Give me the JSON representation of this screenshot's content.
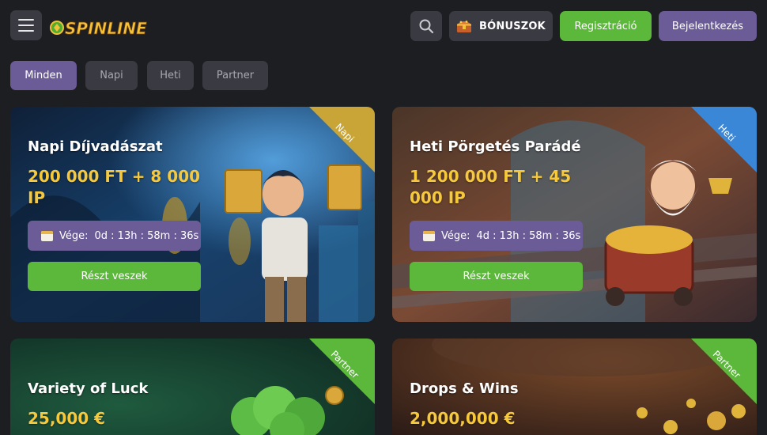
{
  "header": {
    "logo_text": "SPINLINE",
    "bonus_label": "BÓNUSZOK",
    "register_label": "Regisztráció",
    "login_label": "Bejelentkezés"
  },
  "tabs": [
    {
      "label": "Minden",
      "active": true
    },
    {
      "label": "Napi",
      "active": false
    },
    {
      "label": "Heti",
      "active": false
    },
    {
      "label": "Partner",
      "active": false
    }
  ],
  "cards": [
    {
      "title": "Napi Díjvadászat",
      "prize": "200 000 FT + 8 000 IP",
      "ribbon": "Napi",
      "timer_label": "Vége:",
      "timer_value": "0d : 13h : 58m : 36s",
      "button": "Részt veszek"
    },
    {
      "title": "Heti Pörgetés Parádé",
      "prize": "1 200 000 FT + 45 000 IP",
      "ribbon": "Heti",
      "timer_label": "Vége:",
      "timer_value": "4d : 13h : 58m : 36s",
      "button": "Részt veszek"
    },
    {
      "title": "Variety of Luck",
      "prize": "25,000 €",
      "ribbon": "Partner"
    },
    {
      "title": "Drops & Wins",
      "prize": "2,000,000 €",
      "ribbon": "Partner"
    }
  ],
  "colors": {
    "background": "#1d1e22",
    "accent_green": "#5cb83a",
    "accent_purple": "#6b5c97",
    "prize_gold": "#f6c83c",
    "ribbon_napi": "#c9a437",
    "ribbon_heti": "#3a87d8",
    "ribbon_partner": "#5cb83a"
  },
  "icons": [
    "hamburger-menu-icon",
    "search-icon",
    "treasure-chest-icon",
    "calendar-icon"
  ]
}
